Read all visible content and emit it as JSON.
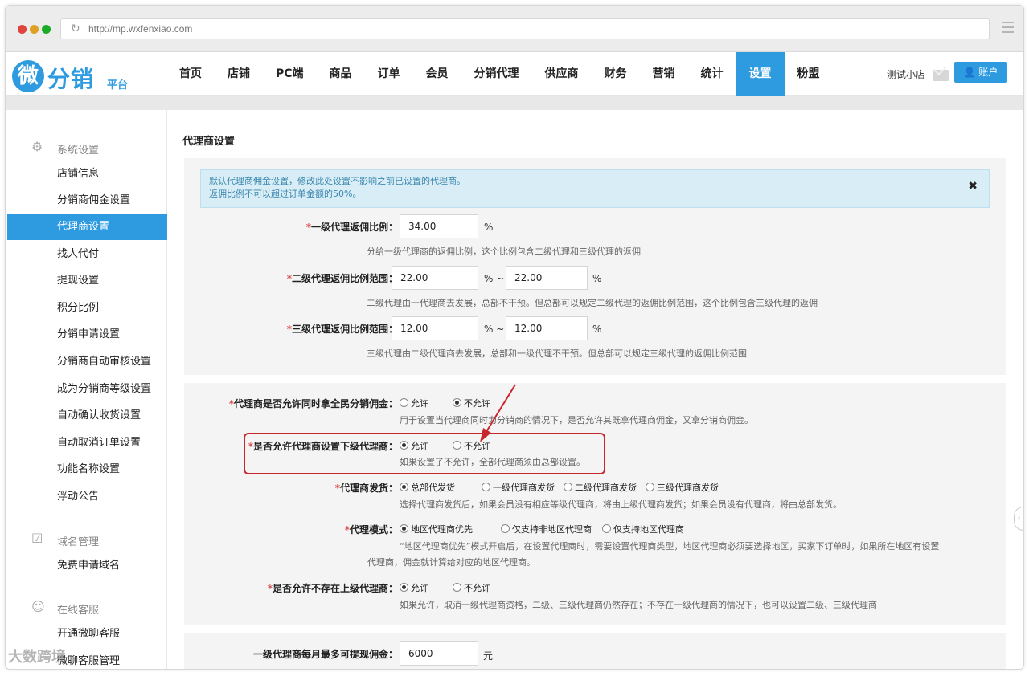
{
  "browser": {
    "url": "http://mp.wxfenxiao.com",
    "dot_colors": [
      "#e0443e",
      "#dea123",
      "#1aab29"
    ]
  },
  "logo": {
    "mark": "微",
    "text": "分销",
    "sub": "平台"
  },
  "nav": {
    "items": [
      "首页",
      "店铺",
      "PC端",
      "商品",
      "订单",
      "会员",
      "分销代理",
      "供应商",
      "财务",
      "营销",
      "统计",
      "设置",
      "粉盟"
    ],
    "active_index": 11,
    "shop_name": "测试小店",
    "account_label": "账户"
  },
  "sidebar": {
    "groups": [
      {
        "icon": "gear-icon",
        "label": "系统设置"
      },
      {
        "icon": "clipboard-check-icon",
        "label": "域名管理"
      },
      {
        "icon": "chat-bubble-icon",
        "label": "在线客服"
      }
    ],
    "system_items": [
      "店铺信息",
      "分销商佣金设置",
      "代理商设置",
      "找人代付",
      "提现设置",
      "积分比例",
      "分销申请设置",
      "分销商自动审核设置",
      "成为分销商等级设置",
      "自动确认收货设置",
      "自动取消订单设置",
      "功能名称设置",
      "浮动公告"
    ],
    "domain_items": [
      "免费申请域名"
    ],
    "service_items": [
      "开通微聊客服",
      "微聊客服管理"
    ],
    "active_item": "代理商设置"
  },
  "page": {
    "title": "代理商设置",
    "alert": {
      "line1": "默认代理商佣金设置，修改此处设置不影响之前已设置的代理商。",
      "line2": "返佣比例不可以超过订单金额的50%。",
      "close": "✖"
    },
    "required_mark": "*",
    "level1": {
      "label": "一级代理返佣比例：",
      "value": "34.00",
      "unit": "%",
      "help": "分给一级代理商的返佣比例，这个比例包含二级代理和三级代理的返佣"
    },
    "level2": {
      "label": "二级代理返佣比例范围：",
      "min": "22.00",
      "sep": "% ~",
      "max": "22.00",
      "unit": "%",
      "help": "二级代理由一代理商去发展，总部不干预。但总部可以规定二级代理的返佣比例范围，这个比例包含三级代理的返佣"
    },
    "level3": {
      "label": "三级代理返佣比例范围：",
      "min": "12.00",
      "sep": "% ~",
      "max": "12.00",
      "unit": "%",
      "help": "三级代理由二级代理商去发展，总部和一级代理不干预。但总部可以规定三级代理的返佣比例范围"
    },
    "allow_dual": {
      "label": "代理商是否允许同时拿全民分销佣金：",
      "options": [
        "允许",
        "不允许"
      ],
      "selected": 1,
      "help": "用于设置当代理商同时为分销商的情况下，是否允许其既拿代理商佣金，又拿分销商佣金。"
    },
    "allow_sub": {
      "label": "是否允许代理商设置下级代理商：",
      "options": [
        "允许",
        "不允许"
      ],
      "selected": 0,
      "help": "如果设置了不允许，全部代理商须由总部设置。"
    },
    "shipping": {
      "label": "代理商发货：",
      "options": [
        "总部代发货",
        "一级代理商发货",
        "二级代理商发货",
        "三级代理商发货"
      ],
      "selected": 0,
      "help": "选择代理商发货后，如果会员没有相应等级代理商，将由上级代理商发货；如果会员没有代理商，将由总部发货。"
    },
    "mode": {
      "label": "代理模式：",
      "options": [
        "地区代理商优先",
        "仅支持非地区代理商",
        "仅支持地区代理商"
      ],
      "selected": 0,
      "help1": "“地区代理商优先”模式开启后，在设置代理商时，需要设置代理商类型，地区代理商必须要选择地区，买家下订单时，如果所在地区有设置",
      "help2": "代理商，佣金就计算给对应的地区代理商。"
    },
    "allow_no_parent": {
      "label": "是否允许不存在上级代理商：",
      "options": [
        "允许",
        "不允许"
      ],
      "selected": 0,
      "help": "如果允许，取消一级代理商资格，二级、三级代理商仍然存在；不存在一级代理商的情况下，也可以设置二级、三级代理商"
    },
    "withdraw": {
      "label": "一级代理商每月最多可提现佣金：",
      "value": "6000",
      "unit": "元"
    }
  },
  "colors": {
    "accent": "#2e9be0",
    "annotation": "#c7282c",
    "required": "#d9534f"
  },
  "watermark": "大数跨境"
}
